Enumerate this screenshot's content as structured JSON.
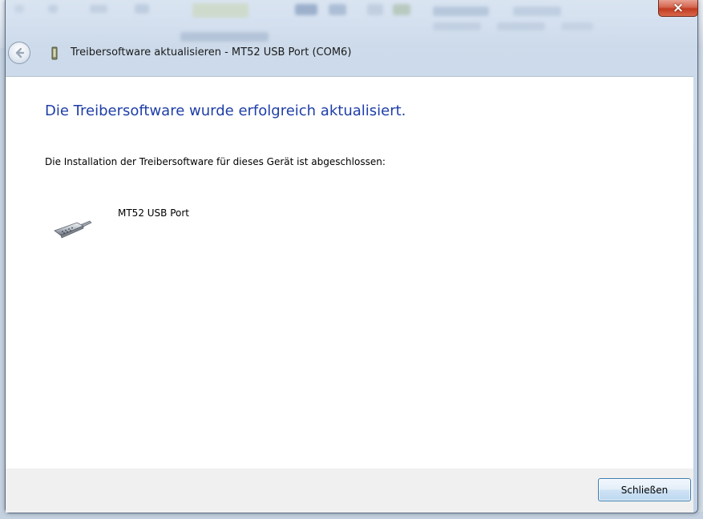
{
  "window": {
    "title": "Treibersoftware aktualisieren - MT52 USB Port (COM6)",
    "close_glyph": "×"
  },
  "main": {
    "heading": "Die Treibersoftware wurde erfolgreich aktualisiert.",
    "description": "Die Installation der Treibersoftware für dieses Gerät ist abgeschlossen:",
    "device_name": "MT52 USB Port"
  },
  "footer": {
    "close_label": "Schließen"
  },
  "colors": {
    "heading": "#1e3ea8",
    "close_button_red": "#c23b20",
    "button_border": "#3c7fb1"
  },
  "icons": {
    "back": "back-arrow-icon",
    "title": "device-icon",
    "device": "serial-port-icon"
  }
}
